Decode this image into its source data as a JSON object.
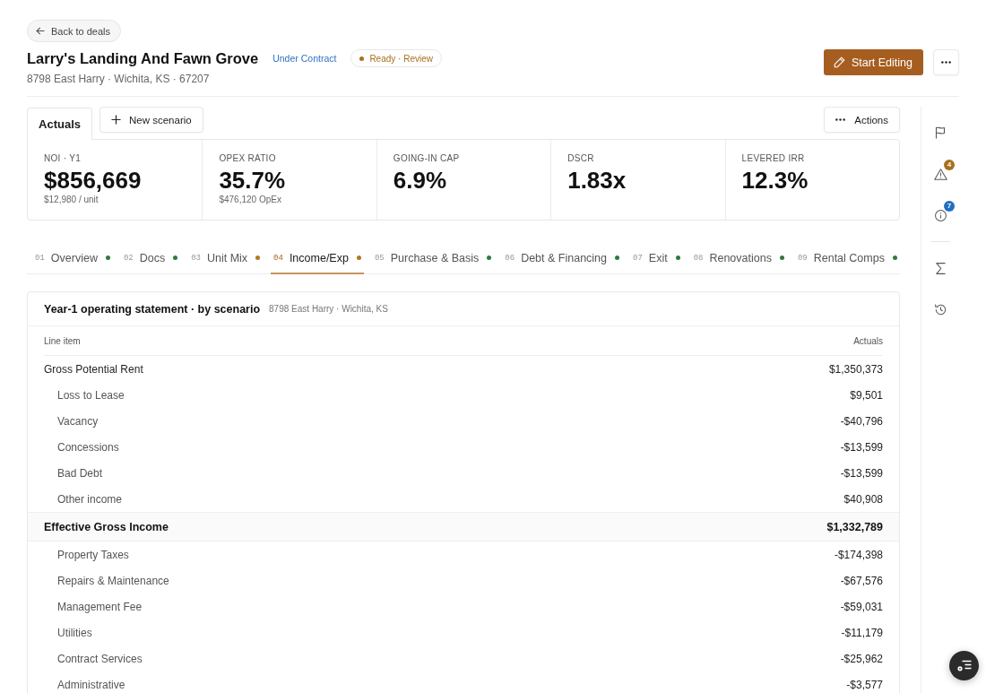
{
  "back_button": {
    "label": "Back to deals"
  },
  "deal": {
    "title": "Larry's Landing And Fawn Grove",
    "stage": "Under Contract",
    "status": "Ready · Review",
    "address": "8798 East Harry · Wichita, KS · 67207"
  },
  "edit_button": {
    "label": "Start Editing"
  },
  "scenario_tabs": [
    {
      "label": "Actuals",
      "selected": true
    }
  ],
  "new_scenario_button": {
    "label": "New scenario"
  },
  "actions_button": {
    "label": "Actions"
  },
  "kpis": [
    {
      "label": "NOI · Y1",
      "value": "$856,669",
      "sub": "$12,980 / unit"
    },
    {
      "label": "OPEX RATIO",
      "value": "35.7%",
      "sub": "$476,120 OpEx"
    },
    {
      "label": "GOING-IN CAP",
      "value": "6.9%"
    },
    {
      "label": "DSCR",
      "value": "1.83x"
    },
    {
      "label": "LEVERED IRR",
      "value": "12.3%"
    }
  ],
  "steps": [
    {
      "number": "01",
      "label": "Overview",
      "color": "#2f7a3b",
      "selected": false
    },
    {
      "number": "02",
      "label": "Docs",
      "color": "#2f7a3b",
      "selected": false
    },
    {
      "number": "03",
      "label": "Unit Mix",
      "color": "#b07a1e",
      "selected": false
    },
    {
      "number": "04",
      "label": "Income/Exp",
      "color": "#b07a1e",
      "selected": true
    },
    {
      "number": "05",
      "label": "Purchase & Basis",
      "color": "#2f7a3b",
      "selected": false
    },
    {
      "number": "06",
      "label": "Debt & Financing",
      "color": "#2f7a3b",
      "selected": false
    },
    {
      "number": "07",
      "label": "Exit",
      "color": "#2f7a3b",
      "selected": false
    },
    {
      "number": "08",
      "label": "Renovations",
      "color": "#2f7a3b",
      "selected": false
    },
    {
      "number": "09",
      "label": "Rental Comps",
      "color": "#2f7a3b",
      "selected": false
    }
  ],
  "statement": {
    "title": "Year-1 operating statement · by scenario",
    "subtitle": "8798 East Harry · Wichita, KS",
    "columns": [
      "Line item",
      "Actuals"
    ],
    "rows": [
      {
        "kind": "line",
        "label": "Gross Potential Rent",
        "value": "$1,350,373",
        "children": [
          {
            "label": "Loss to Lease",
            "value": "$9,501"
          },
          {
            "label": "Vacancy",
            "value": "-$40,796"
          },
          {
            "label": "Concessions",
            "value": "-$13,599"
          },
          {
            "label": "Bad Debt",
            "value": "-$13,599"
          },
          {
            "label": "Other income",
            "value": "$40,908"
          }
        ]
      },
      {
        "kind": "subtotal",
        "label": "Effective Gross Income",
        "value": "$1,332,789",
        "children": [
          {
            "label": "Property Taxes",
            "value": "-$174,398"
          },
          {
            "label": "Repairs & Maintenance",
            "value": "-$67,576"
          },
          {
            "label": "Management Fee",
            "value": "-$59,031"
          },
          {
            "label": "Utilities",
            "value": "-$11,179"
          },
          {
            "label": "Contract Services",
            "value": "-$25,962"
          },
          {
            "label": "Administrative",
            "value": "-$3,577"
          }
        ]
      }
    ]
  },
  "rail": [
    {
      "kind": "flag"
    },
    {
      "kind": "warning",
      "badge": "4",
      "color": "#a8701e"
    },
    {
      "kind": "info",
      "badge": "7",
      "color": "#1f6fc4"
    },
    {
      "kind": "divider"
    },
    {
      "kind": "sigma"
    },
    {
      "kind": "history"
    }
  ]
}
